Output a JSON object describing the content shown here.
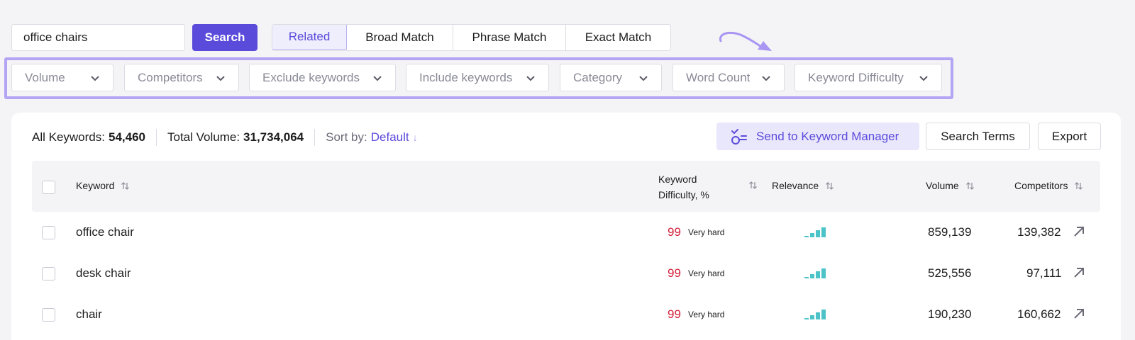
{
  "search": {
    "query": "office chairs",
    "button_label": "Search"
  },
  "match_tabs": [
    {
      "label": "Related",
      "active": true
    },
    {
      "label": "Broad Match",
      "active": false
    },
    {
      "label": "Phrase Match",
      "active": false
    },
    {
      "label": "Exact Match",
      "active": false
    }
  ],
  "filters": [
    {
      "label": "Volume"
    },
    {
      "label": "Competitors"
    },
    {
      "label": "Exclude keywords"
    },
    {
      "label": "Include keywords"
    },
    {
      "label": "Category"
    },
    {
      "label": "Word Count"
    },
    {
      "label": "Keyword Difficulty"
    }
  ],
  "stats": {
    "all_keywords_label": "All Keywords:",
    "all_keywords_value": "54,460",
    "total_volume_label": "Total Volume:",
    "total_volume_value": "31,734,064",
    "sort_label": "Sort by:",
    "sort_value": "Default",
    "sort_arrow": "↓"
  },
  "actions": {
    "send_label": "Send to Keyword Manager",
    "search_terms_label": "Search Terms",
    "export_label": "Export"
  },
  "table": {
    "headers": {
      "keyword": "Keyword",
      "kd_line1": "Keyword",
      "kd_line2": "Difficulty, %",
      "relevance": "Relevance",
      "volume": "Volume",
      "competitors": "Competitors"
    },
    "rows": [
      {
        "keyword": "office chair",
        "kd": "99",
        "kd_label": "Very hard",
        "volume": "859,139",
        "competitors": "139,382"
      },
      {
        "keyword": "desk chair",
        "kd": "99",
        "kd_label": "Very hard",
        "volume": "525,556",
        "competitors": "97,111"
      },
      {
        "keyword": "chair",
        "kd": "99",
        "kd_label": "Very hard",
        "volume": "190,230",
        "competitors": "160,662"
      }
    ]
  },
  "colors": {
    "accent": "#5b4bdb",
    "highlight_frame": "#b3a4f4",
    "difficulty_red": "#d4213b",
    "relevance_teal": "#4bc3c8"
  }
}
